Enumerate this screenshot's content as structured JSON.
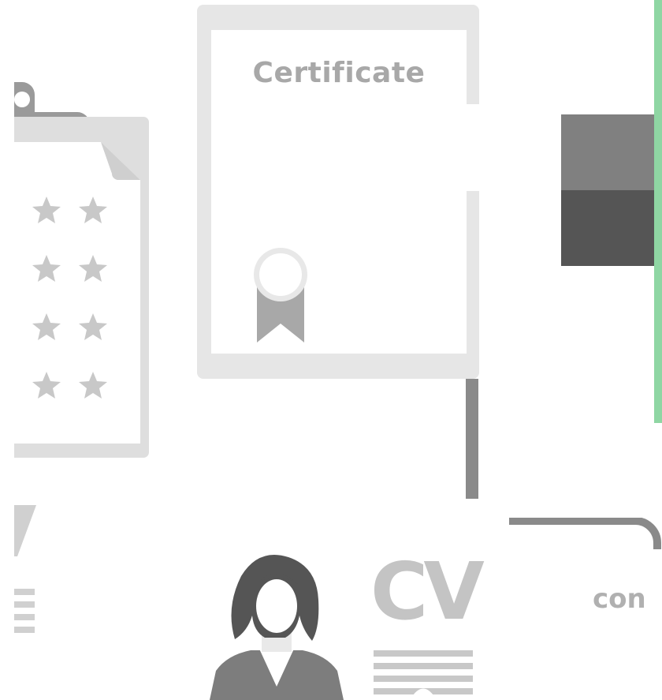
{
  "certificate": {
    "title": "Certificate"
  },
  "resume": {
    "cv_label": "CV"
  },
  "card_right": {
    "partial_label": "con"
  },
  "colors": {
    "accent_green": "#8fd6a3",
    "certificate_frame": "#e6e6e6",
    "dark_block": "#555555",
    "mid_block": "#808080"
  }
}
